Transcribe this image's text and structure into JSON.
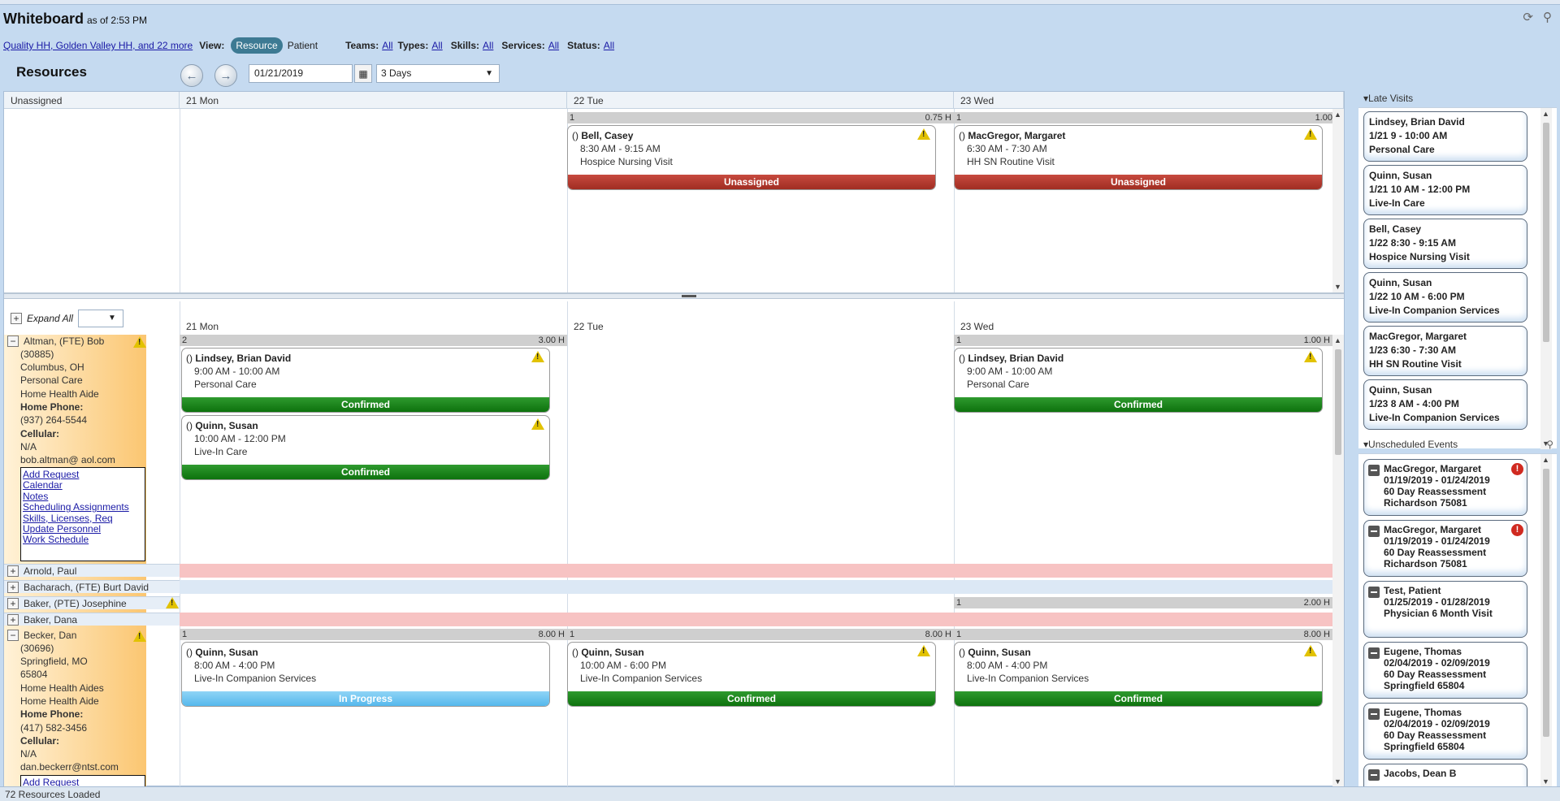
{
  "header": {
    "title": "Whiteboard",
    "as_of": "as of 2:53 PM"
  },
  "filters": {
    "locations_link": "Quality HH, Golden Valley HH, and 22 more",
    "view_label": "View:",
    "view_resource": "Resource",
    "view_patient": "Patient",
    "teams_label": "Teams:",
    "teams_value": "All",
    "types_label": "Types:",
    "types_value": "All",
    "skills_label": "Skills:",
    "skills_value": "All",
    "services_label": "Services:",
    "services_value": "All",
    "status_label": "Status:",
    "status_value": "All"
  },
  "toolbar": {
    "section_title": "Resources",
    "date": "01/21/2019",
    "range": "3 Days"
  },
  "columns": {
    "unassigned": "Unassigned",
    "day1": "21 Mon",
    "day2": "22 Tue",
    "day3": "23 Wed"
  },
  "unassigned": {
    "day2_bar": {
      "count": "1",
      "hours": "0.75 H"
    },
    "day3_bar": {
      "count": "1",
      "hours": "1.00 H"
    },
    "cards": [
      {
        "prefix": "()",
        "name": "Bell, Casey",
        "time": "8:30 AM - 9:15 AM",
        "service": "Hospice Nursing Visit",
        "status": "Unassigned"
      },
      {
        "prefix": "()",
        "name": "MacGregor, Margaret",
        "time": "6:30 AM - 7:30 AM",
        "service": "HH SN Routine Visit",
        "status": "Unassigned"
      }
    ]
  },
  "resources_toolbar": {
    "expand_all": "Expand All"
  },
  "altman": {
    "name": "Altman, (FTE) Bob",
    "lines": [
      "(30885)",
      "Columbus, OH",
      "Personal Care",
      "Home Health Aide"
    ],
    "home_phone_label": "Home Phone:",
    "home_phone": "(937) 264-5544",
    "cellular_label": "Cellular:",
    "cellular": "N/A",
    "email": "bob.altman@ aol.com",
    "links": [
      "Add Request",
      "Calendar",
      "Notes",
      "Scheduling Assignments",
      "Skills, Licenses, Req",
      "Update Personnel",
      "Work Schedule"
    ],
    "day1_bar": {
      "count": "2",
      "hours": "3.00 H"
    },
    "day3_bar": {
      "count": "1",
      "hours": "1.00 H"
    },
    "cards": [
      {
        "prefix": "()",
        "name": "Lindsey, Brian David",
        "time": "9:00 AM - 10:00 AM",
        "service": "Personal Care",
        "status": "Confirmed"
      },
      {
        "prefix": "()",
        "name": "Quinn, Susan",
        "time": "10:00 AM - 12:00 PM",
        "service": "Live-In Care",
        "status": "Confirmed"
      },
      {
        "prefix": "()",
        "name": "Lindsey, Brian David",
        "time": "9:00 AM - 10:00 AM",
        "service": "Personal Care",
        "status": "Confirmed"
      }
    ]
  },
  "collapsed_rows": [
    {
      "name": "Arnold, Paul"
    },
    {
      "name": "Bacharach, (FTE) Burt David"
    },
    {
      "name": "Baker, (PTE) Josephine",
      "day3_bar": {
        "count": "1",
        "hours": "2.00 H"
      }
    },
    {
      "name": "Baker, Dana"
    }
  ],
  "becker": {
    "name": "Becker, Dan",
    "lines": [
      "(30696)",
      "Springfield, MO",
      "65804",
      "Home Health Aides",
      "Home Health Aide"
    ],
    "home_phone_label": "Home Phone:",
    "home_phone": "(417) 582-3456",
    "cellular_label": "Cellular:",
    "cellular": "N/A",
    "email": "dan.beckerr@ntst.com",
    "link_partial": "Add Request",
    "bars": [
      {
        "count": "1",
        "hours": "8.00 H"
      },
      {
        "count": "1",
        "hours": "8.00 H"
      },
      {
        "count": "1",
        "hours": "8.00 H"
      }
    ],
    "cards": [
      {
        "prefix": "()",
        "name": "Quinn, Susan",
        "time": "8:00 AM - 4:00 PM",
        "service": "Live-In Companion Services",
        "status": "In Progress"
      },
      {
        "prefix": "()",
        "name": "Quinn, Susan",
        "time": "10:00 AM - 6:00 PM",
        "service": "Live-In Companion Services",
        "status": "Confirmed"
      },
      {
        "prefix": "()",
        "name": "Quinn, Susan",
        "time": "8:00 AM - 4:00 PM",
        "service": "Live-In Companion Services",
        "status": "Confirmed"
      }
    ]
  },
  "late_visits": {
    "title": "Late Visits",
    "items": [
      {
        "name": "Lindsey, Brian David",
        "when": "1/21 9 - 10:00 AM",
        "service": "Personal Care"
      },
      {
        "name": "Quinn, Susan",
        "when": "1/21 10 AM - 12:00 PM",
        "service": "Live-In Care"
      },
      {
        "name": "Bell, Casey",
        "when": "1/22 8:30 - 9:15 AM",
        "service": "Hospice Nursing Visit"
      },
      {
        "name": "Quinn, Susan",
        "when": "1/22 10 AM - 6:00 PM",
        "service": "Live-In Companion Services"
      },
      {
        "name": "MacGregor, Margaret",
        "when": "1/23 6:30 - 7:30 AM",
        "service": "HH SN Routine Visit"
      },
      {
        "name": "Quinn, Susan",
        "when": "1/23 8 AM - 4:00 PM",
        "service": "Live-In Companion Services"
      }
    ]
  },
  "unscheduled": {
    "title": "Unscheduled Events",
    "items": [
      {
        "name": "MacGregor, Margaret",
        "dates": "01/19/2019 - 01/24/2019",
        "event": "60 Day Reassessment",
        "location": "Richardson 75081",
        "error": "!"
      },
      {
        "name": "MacGregor, Margaret",
        "dates": "01/19/2019 - 01/24/2019",
        "event": "60 Day Reassessment",
        "location": "Richardson 75081",
        "error": "!"
      },
      {
        "name": "Test, Patient",
        "dates": "01/25/2019 - 01/28/2019",
        "event": "Physician 6 Month Visit",
        "location": ""
      },
      {
        "name": "Eugene, Thomas",
        "dates": "02/04/2019 - 02/09/2019",
        "event": "60 Day Reassessment",
        "location": "Springfield 65804"
      },
      {
        "name": "Eugene, Thomas",
        "dates": "02/04/2019 - 02/09/2019",
        "event": "60 Day Reassessment",
        "location": "Springfield 65804"
      },
      {
        "name": "Jacobs, Dean B",
        "dates": "",
        "event": "",
        "location": ""
      }
    ]
  },
  "statusbar": {
    "text": "72 Resources Loaded"
  }
}
